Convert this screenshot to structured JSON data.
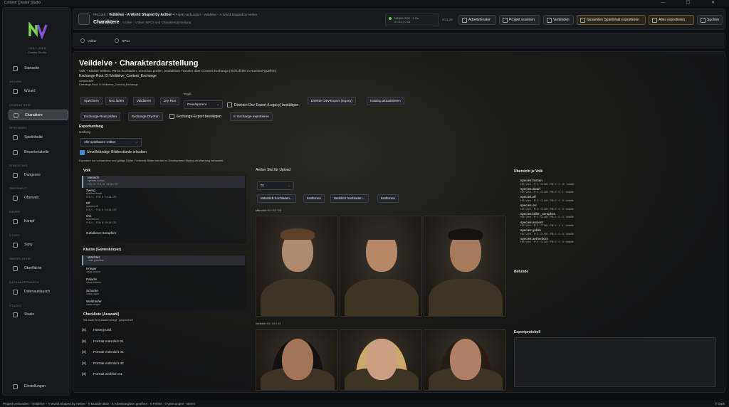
{
  "window": {
    "title": "Content Creator Studio",
    "controls": "— ☐ ✕"
  },
  "sidebar": {
    "version": "V0.5.2 | 0.4.8",
    "app": "Creator Studio",
    "items": [
      {
        "section": "",
        "label": "Startseite"
      },
      {
        "section": "WIZARD",
        "label": "Wizard"
      },
      {
        "section": "CHARAKTERE",
        "label": "Charaktere"
      },
      {
        "section": "SPIELWAHL",
        "label": "Spielinhalte"
      },
      {
        "section": "",
        "label": "Bewertertabelle"
      },
      {
        "section": "DUNGEONS",
        "label": "Dungeons"
      },
      {
        "section": "OBERWELT",
        "label": "Oberwelt"
      },
      {
        "section": "KAMPF",
        "label": "Kampf"
      },
      {
        "section": "STORY",
        "label": "Story"
      },
      {
        "section": "OBERFLÄCHE",
        "label": "Oberfläche"
      },
      {
        "section": "DATENAUSTAUSCH",
        "label": "Datenaustausch"
      },
      {
        "section": "STUDIO",
        "label": "Studio"
      },
      {
        "section": "",
        "label": "Einstellungen"
      }
    ]
  },
  "topbar": {
    "project_prefix": "PROJEKT",
    "project_name": "Veildelve - A World Shaped by Aether",
    "project_extra": "• Projekt verbunden · Veildelve – A World Shaped by Aether",
    "title": "Charaktere",
    "breadcrumb": "/  Völker  ·  Völker, NPCs und Charakterdarstellung",
    "status_line1": "DEADLOCK · 0 Gn",
    "status_line2": "0 0 12 | 0 16",
    "version": "v0.5.28",
    "buttons": [
      "Arbeitsfenster",
      "Projekt scannen",
      "Verbinden",
      "Gesamten Spielinhalt exportieren",
      "Alles exportieren",
      "Suchen"
    ]
  },
  "tabs": [
    "Völker",
    "NPCs"
  ],
  "main": {
    "title": "Veildelve · Charakterdarstellung",
    "desc": "Volk + Klasse wählen, PNGs hochladen, Vorschau prüfen, produktiver Transfer über Content Exchange (nicht direkt in Runtime-Quellen).",
    "exchange_root": "Exchange-Root: D:\\Veildelve_Content_Exchange",
    "saved": "Gespeichert",
    "exchange_root2": "Exchange-Root: D:\\Veildelve_Content_Exchange",
    "profile_label": "Profil",
    "profile_value": "Development",
    "row1": [
      "Speichern",
      "Neu laden",
      "Validieren",
      "Dry-Run"
    ],
    "direct_dev": "Direkten Dev-Export (Legacy) bestätigen",
    "row1b": [
      "Direkter Dev-Export (legacy)",
      "Katalog aktualisieren"
    ],
    "row2": [
      "Exchange-Root prüfen",
      "Exchange Dry-Run"
    ],
    "exchange_confirm": "Exchange-Export bestätigen",
    "exchange_export": "In Exchange exportieren",
    "export_scope_label": "Exportumfang",
    "scope_label": "Umfang",
    "scope_value": "Alle spielbaren Völker",
    "allow_incomplete": "Unvollständige Bildbestände erlauben",
    "note": "Exportiert nur vorhandene und gültige Bilder. Fehlende Bilder werden im Development-Modus als Warnung behandelt.",
    "volk_header": "Volk",
    "voelker": [
      {
        "name": "Mensch",
        "sub": "species.human",
        "stat": "H:5 / 5 · P:5 / 6 · M:18 / 20"
      },
      {
        "name": "Zwerg",
        "sub": "species.dwarf",
        "stat": "H:5 / 1 · P:5 / 6 · M:18 / 20"
      },
      {
        "name": "Elf",
        "sub": "species.elf",
        "stat": "H:5 / 1 · P:5 / 6 · M:18 / 20"
      },
      {
        "name": "Ork",
        "sub": "species.orc",
        "stat": "H:5 / 1 · P:5 / 6 · M:18 / 20"
      },
      {
        "name": "Gefallener Seraphim",
        "sub": "",
        "stat": ""
      }
    ],
    "klasse_header": "Klasse (Gameskörper)",
    "klassen": [
      {
        "name": "Wächter",
        "sub": "class.guardian"
      },
      {
        "name": "Krieger",
        "sub": "class.warrior"
      },
      {
        "name": "Paladin",
        "sub": "class.paladin"
      },
      {
        "name": "Schurke",
        "sub": "class.rogue"
      },
      {
        "name": "Waldläufer",
        "sub": "class.ranger"
      }
    ],
    "checklist_header": "Checkliste (Auswahl)",
    "checklist_sub": "5/6 Slots für Auswahl belegt · gespeichert",
    "checklist": [
      {
        "mark": "[X]",
        "label": "Hintergrund"
      },
      {
        "mark": "[X]",
        "label": "Portrait männlich 01"
      },
      {
        "mark": "[X]",
        "label": "Portrait männlich 02"
      },
      {
        "mark": "[X]",
        "label": "Portrait männlich 03"
      },
      {
        "mark": "[X]",
        "label": "Portrait weiblich 01"
      }
    ],
    "upload_header": "Aether Slot für Upload",
    "slot_value": "01",
    "upload_buttons": [
      "Männlich hochladen...",
      "Entfernen",
      "Weiblich hochladen...",
      "Entfernen"
    ],
    "male_label": "Männlich 01 / 02 / 03",
    "female_label": "Weiblich 01 / 02 / 03",
    "overview_header": "Übersicht je Volk",
    "overview": [
      {
        "name": "species.human",
        "stat": "HG: Vorh. · P: 3 · O: 5/6 · PB: 3 · 0 · Ø · Inhalte"
      },
      {
        "name": "species.dwarf",
        "stat": "HG: Vorh. · P: 3 · O: 5/6 · PB: 0 · 0 · 1 · Inhalte"
      },
      {
        "name": "species.elf",
        "stat": "HG: Vorh. · P: 3 · O: 5/6 · PB: 0 · 0 · 0 · Inhalte"
      },
      {
        "name": "species.orc",
        "stat": "HG: Vorh. · P: 3 · O: 5/6 · PB: 0 · 0 · 0 · Inhalte"
      },
      {
        "name": "species.fallen_seraphim",
        "stat": "HG: Vorh. · P: 3 · O: 5/6 · PB: 2 · 0 · 2 · Inhalte"
      },
      {
        "name": "species.ancient",
        "stat": "HG: Vorh. · P: 3 · O: 5/6 · PB: 2 · 1 · 1 · Inhalte"
      },
      {
        "name": "species.goblin",
        "stat": "HG: Vorh. · P: 3 · O: 5/6 · PB: 0 · 0 · 0 · Inhalte"
      },
      {
        "name": "species.aetherborn",
        "stat": "HG: Vorh. · P: 3 · O: 5/6 · PB: 0 · 0 · 0 · Inhalte"
      }
    ],
    "befunde": "Befunde",
    "export_log": "Exportprotokoll"
  },
  "statusbar": {
    "text": "Projekt verbunden · Veildelve – A World Shaped by Aether · 6 Module aktiv · 6 Arbeitsregister geöffnet · 0 Fehler · 0 Warnungen · Bereit",
    "right": "© Dark"
  },
  "colors": {
    "accent": "#3b8fd6",
    "logo_green": "#7bd14a",
    "logo_purple": "#8a4fd0"
  }
}
